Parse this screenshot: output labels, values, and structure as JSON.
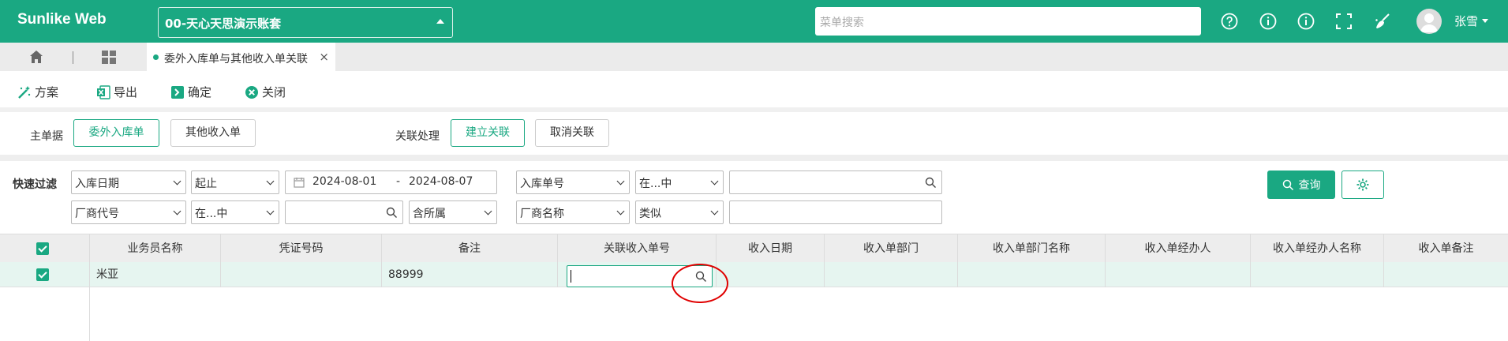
{
  "header": {
    "brand": "Sunlike Web",
    "company": "00-天心天思演示账套",
    "menu_search_placeholder": "菜单搜索",
    "icons": [
      "help-icon",
      "info-icon",
      "info-icon",
      "fullscreen-icon",
      "broom-icon"
    ],
    "user_name": "张雪"
  },
  "tabs": {
    "active_tab": "委外入库单与其他收入单关联",
    "close": "×"
  },
  "toolbar": {
    "scheme": "方案",
    "export": "导出",
    "confirm": "确定",
    "close": "关闭"
  },
  "main": {
    "label": "主单据",
    "btn_outsource": "委外入库单",
    "btn_other": "其他收入单",
    "assoc_label": "关联处理",
    "btn_build": "建立关联",
    "btn_cancel": "取消关联"
  },
  "filter": {
    "label": "快速过滤",
    "f1_field": "入库日期",
    "f1_op": "起止",
    "date_from": "2024-08-01",
    "date_sep": "-",
    "date_to": "2024-08-07",
    "f2_field": "入库单号",
    "f2_op": "在...中",
    "f3_field": "厂商代号",
    "f3_op": "在...中",
    "f3_scope": "含所属",
    "f4_field": "厂商名称",
    "f4_op": "类似",
    "query": "查询"
  },
  "grid": {
    "columns": [
      "业务员名称",
      "凭证号码",
      "备注",
      "关联收入单号",
      "收入日期",
      "收入单部门",
      "收入单部门名称",
      "收入单经办人",
      "收入单经办人名称",
      "收入单备注"
    ],
    "rows": [
      {
        "salesman": "米亚",
        "voucher": "",
        "note": "88999",
        "related_no": "",
        "date": "",
        "dept": "",
        "dept_name": "",
        "handler": "",
        "handler_name": "",
        "remark": ""
      }
    ]
  },
  "colors": {
    "accent": "#1aa882",
    "highlight": "#e00000"
  }
}
